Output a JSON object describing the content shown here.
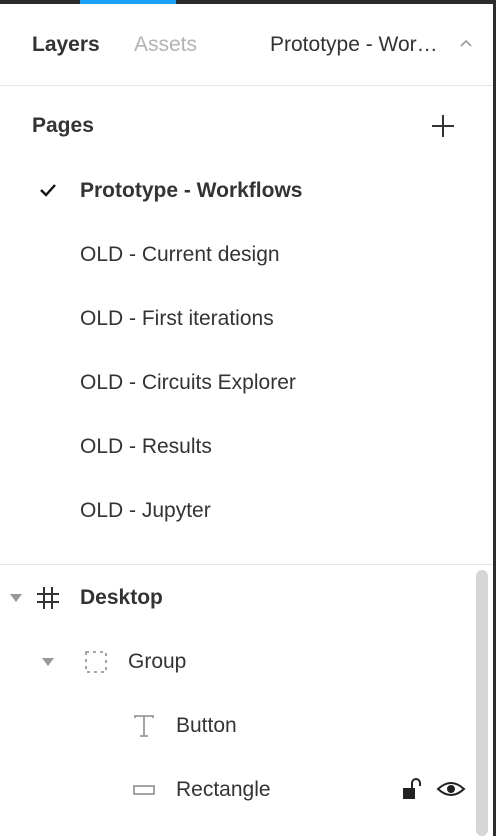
{
  "tabs": {
    "layers": "Layers",
    "assets": "Assets",
    "current_page": "Prototype - Workflows"
  },
  "pages": {
    "title": "Pages",
    "items": [
      {
        "label": "Prototype - Workflows",
        "current": true
      },
      {
        "label": "OLD - Current design",
        "current": false
      },
      {
        "label": "OLD - First iterations",
        "current": false
      },
      {
        "label": "OLD - Circuits Explorer",
        "current": false
      },
      {
        "label": "OLD - Results",
        "current": false
      },
      {
        "label": "OLD - Jupyter",
        "current": false
      }
    ]
  },
  "layers": [
    {
      "name": "Desktop",
      "type": "frame",
      "expanded": true
    },
    {
      "name": "Group",
      "type": "group",
      "expanded": true
    },
    {
      "name": "Button",
      "type": "text"
    },
    {
      "name": "Rectangle",
      "type": "rectangle",
      "locked": false,
      "visible": true
    }
  ],
  "colors": {
    "accent": "#18a0fb",
    "text": "#333333",
    "muted": "#b3b3b3",
    "icon": "#999999"
  },
  "icons": {
    "add_page": "plus-icon",
    "current_page": "check-icon",
    "frame": "hash-icon",
    "group": "dashed-square-icon",
    "text": "text-t-icon",
    "rectangle": "rectangle-icon",
    "lock": "unlock-icon",
    "visibility": "eye-icon",
    "page_switch": "chevron-up-icon",
    "expand": "caret-down-icon"
  }
}
